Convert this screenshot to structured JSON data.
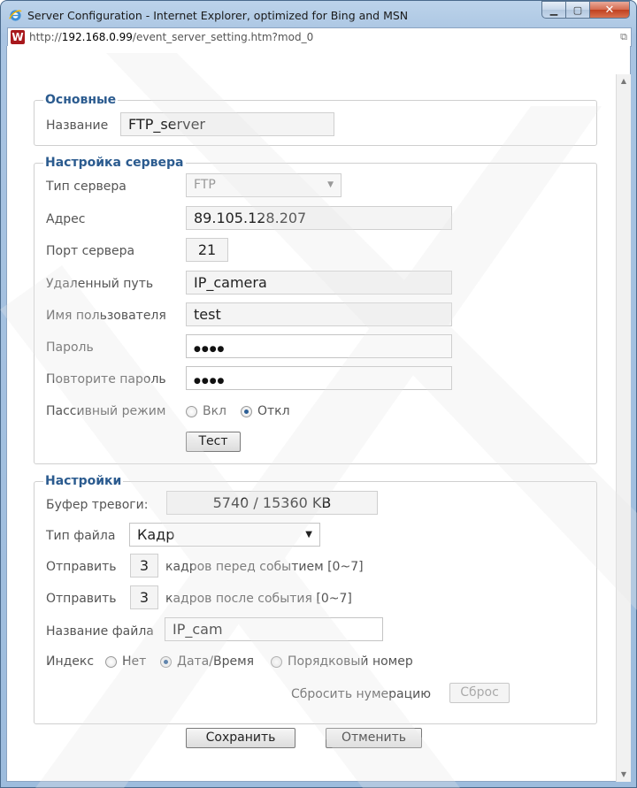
{
  "window": {
    "title": "Server Configuration - Internet Explorer, optimized for Bing and MSN",
    "url_prefix": "http://",
    "url_host": "192.168.0.99",
    "url_path": "/event_server_setting.htm?mod_0"
  },
  "basic": {
    "legend": "Основные",
    "name_label": "Название",
    "name_value": "FTP_server"
  },
  "server": {
    "legend": "Настройка сервера",
    "type_label": "Тип сервера",
    "type_value": "FTP",
    "address_label": "Адрес",
    "address_value": "89.105.128.207",
    "port_label": "Порт сервера",
    "port_value": "21",
    "path_label": "Удаленный путь",
    "path_value": "IP_camera",
    "user_label": "Имя пользователя",
    "user_value": "test",
    "password_label": "Пароль",
    "password_value": "●●●●",
    "repeat_label": "Повторите пароль",
    "repeat_value": "●●●●",
    "passive_label": "Пассивный режим",
    "passive_on": "Вкл",
    "passive_off": "Откл",
    "test_button": "Тест"
  },
  "settings": {
    "legend": "Настройки",
    "buffer_label": "Буфер тревоги:",
    "buffer_value": "5740 / 15360 KB",
    "filetype_label": "Тип файла",
    "filetype_value": "Кадр",
    "send_label": "Отправить",
    "pre_frames": "3",
    "pre_text": "кадров перед событием [0~7]",
    "post_frames": "3",
    "post_text": "кадров после события [0~7]",
    "filename_label": "Название файла",
    "filename_value": "IP_cam",
    "index_label": "Индекс",
    "index_none": "Нет",
    "index_datetime": "Дата/Время",
    "index_seq": "Порядковый номер",
    "reset_label": "Сбросить нумерацию",
    "reset_button": "Сброс"
  },
  "footer": {
    "save_button": "Сохранить",
    "cancel_button": "Отменить"
  }
}
